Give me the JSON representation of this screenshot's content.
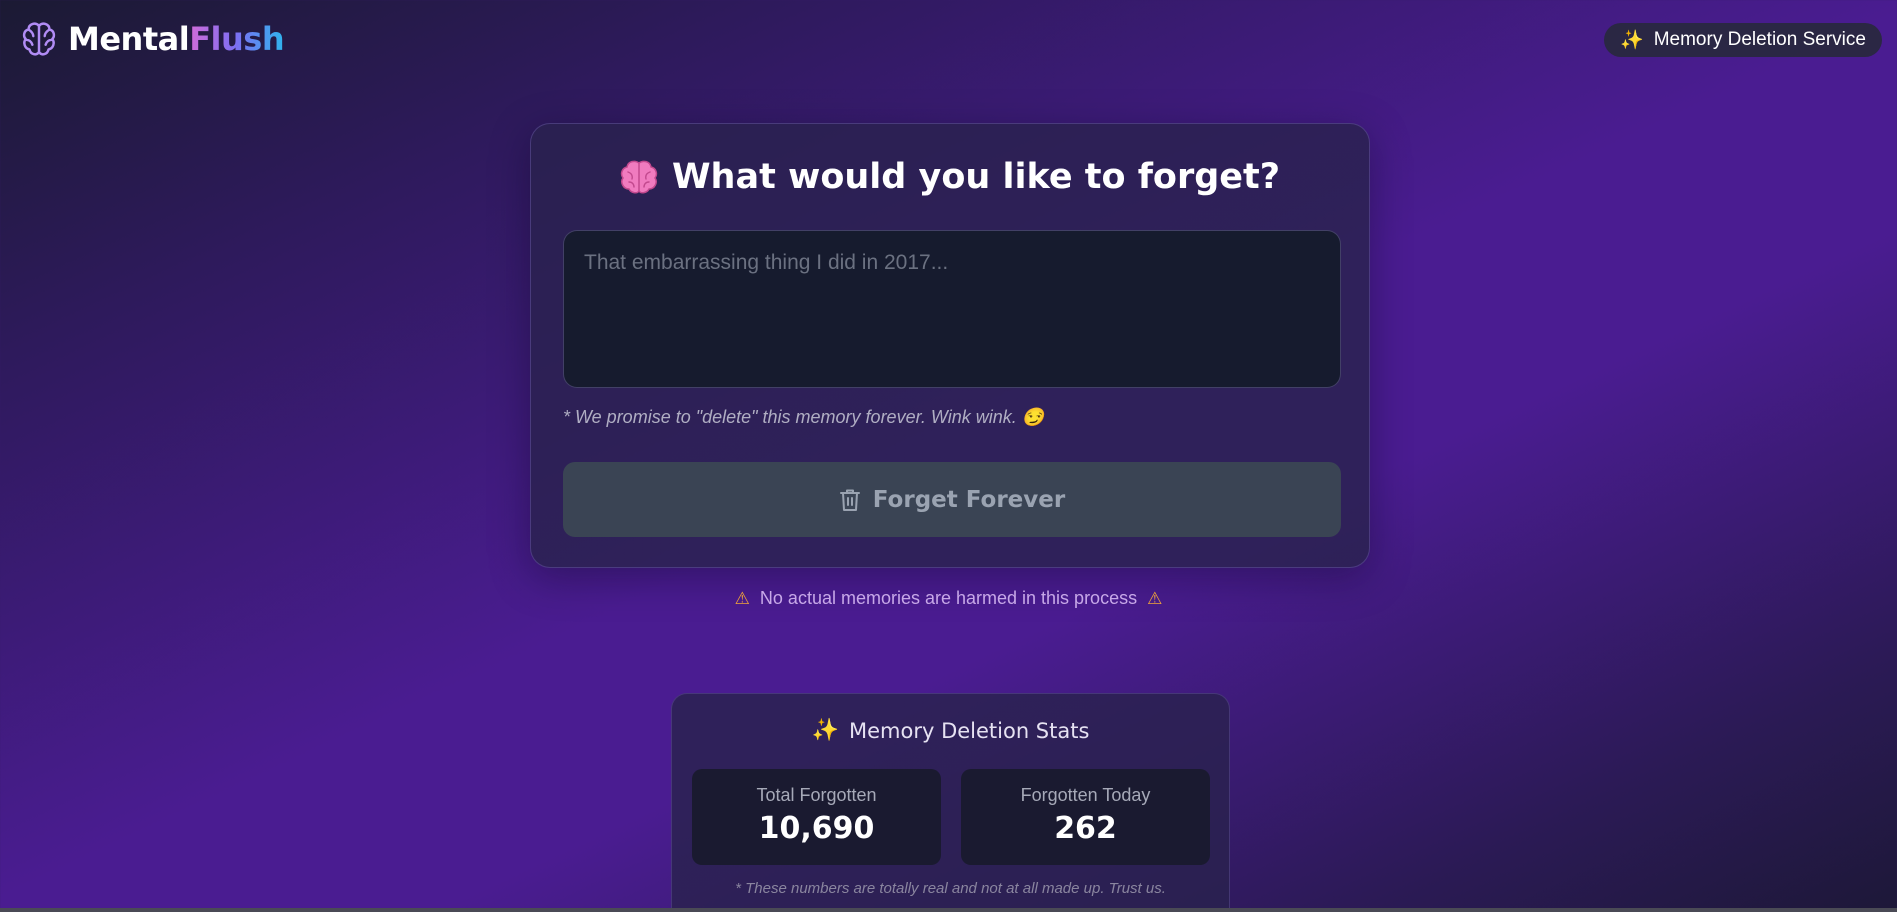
{
  "header": {
    "logo_part1": "Mental",
    "logo_part2": "Flush",
    "logo_icon": "brain-outline-icon",
    "badge": {
      "icon": "sparkles-icon",
      "label": "Memory Deletion Service"
    }
  },
  "main": {
    "title_icon": "brain-emoji",
    "title": "What would you like to forget?",
    "input": {
      "value": "",
      "placeholder": "That embarrassing thing I did in 2017..."
    },
    "promise": "* We promise to \"delete\" this memory forever. Wink wink. 😏",
    "button": {
      "icon": "trash-icon",
      "label": "Forget Forever"
    }
  },
  "disclaimer": {
    "icon": "warning-icon",
    "text": "No actual memories are harmed in this process"
  },
  "stats": {
    "title_icon": "sparkles-icon",
    "title": "Memory Deletion Stats",
    "items": [
      {
        "label": "Total Forgotten",
        "value": "10,690"
      },
      {
        "label": "Forgotten Today",
        "value": "262"
      }
    ],
    "footnote": "* These numbers are totally real and not at all made up. Trust us."
  },
  "colors": {
    "accent_pink": "#d16bd9",
    "accent_blue": "#2fb4ee",
    "background_purple": "#4a1c91",
    "warning": "#f0a33a",
    "sparkle": "#f5c518",
    "button_disabled": "#3a4454"
  }
}
